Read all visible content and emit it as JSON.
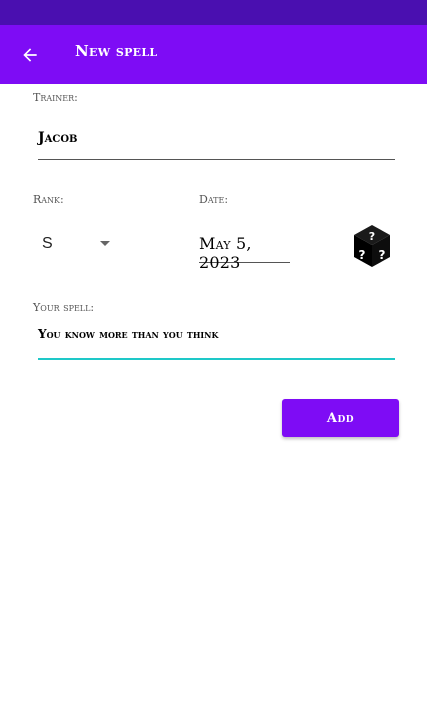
{
  "app_bar": {
    "title": "New spell",
    "back_icon": "arrow-left-icon"
  },
  "form": {
    "trainer": {
      "label": "Trainer:",
      "value": "Jacob"
    },
    "rank": {
      "label": "Rank:",
      "selected": "S"
    },
    "date": {
      "label": "Date:",
      "value": "May 5, 2023"
    },
    "random_icon": "dice-question-icon",
    "spell": {
      "label": "Your spell:",
      "value": "You know more than you think"
    },
    "add_label": "Add"
  },
  "colors": {
    "status_bar": "#4a0fb0",
    "app_bar": "#7e0cf5",
    "button": "#7e0cf5",
    "focus_underline": "#1ec8c8"
  }
}
